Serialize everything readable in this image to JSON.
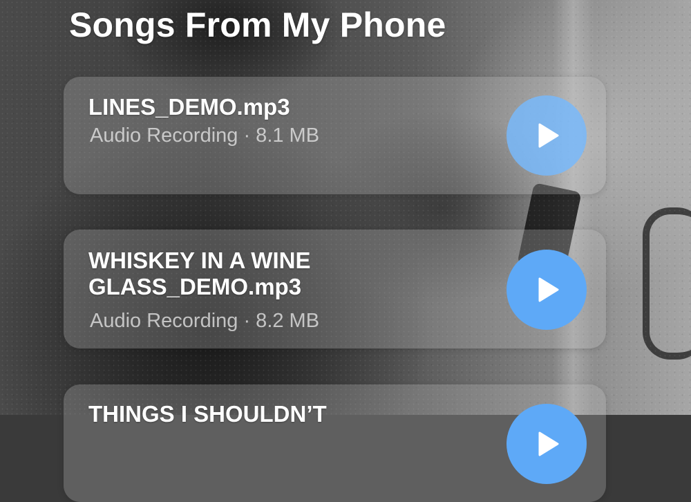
{
  "header": {
    "title": "Songs From My Phone"
  },
  "songs": [
    {
      "name": "LINES_DEMO.mp3",
      "meta": "Audio Recording · 8.1 MB",
      "action": "play-icon"
    },
    {
      "name": "WHISKEY IN A WINE GLASS_DEMO.mp3",
      "meta": "Audio Recording · 8.2 MB",
      "action": "play-icon"
    },
    {
      "name": "THINGS I SHOULDN’T",
      "meta": "",
      "action": "play-icon"
    }
  ],
  "colors": {
    "play_button": "#5ea9f7",
    "title_text": "#ffffff"
  }
}
